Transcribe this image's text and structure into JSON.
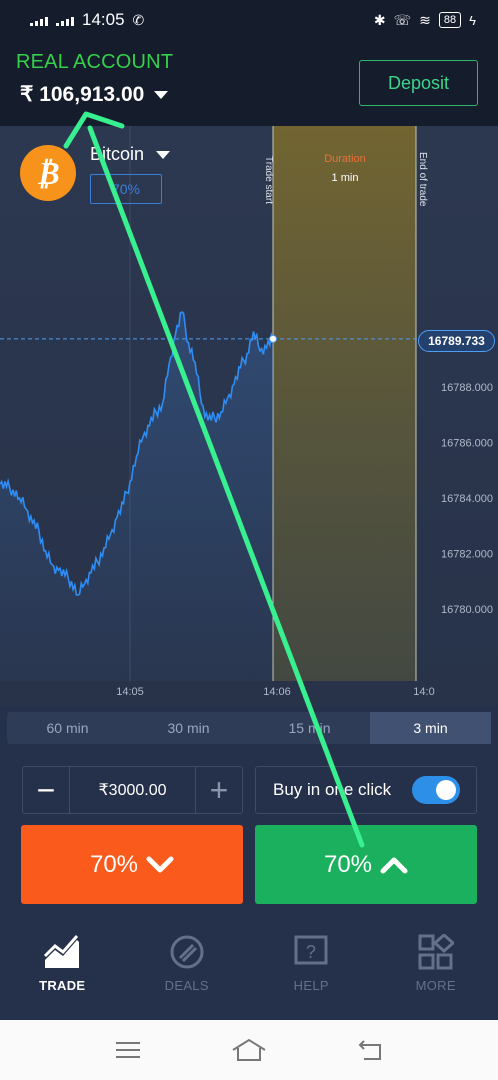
{
  "status_bar": {
    "time": "14:05",
    "battery": "88"
  },
  "header": {
    "account_label": "REAL ACCOUNT",
    "balance": "₹ 106,913.00",
    "deposit_label": "Deposit"
  },
  "asset": {
    "icon_symbol": "₿",
    "name": "Bitcoin",
    "profit": "70%"
  },
  "chart_data": {
    "type": "line",
    "current_price_label": "16789.733",
    "current_price": 16789.733,
    "y_ticks": [
      "16788.000",
      "16786.000",
      "16784.000",
      "16782.000",
      "16780.000"
    ],
    "y_tick_values": [
      16788,
      16786,
      16784,
      16782,
      16780
    ],
    "x_ticks": [
      "14:05",
      "14:06",
      "14:0"
    ],
    "trade_start_label": "Trade start",
    "end_of_trade_label": "End of trade",
    "duration_label": "Duration",
    "duration_value": "1 min",
    "price_series": [
      16784.5,
      16784.4,
      16784.3,
      16784.0,
      16783.6,
      16783.1,
      16782.8,
      16782.1,
      16781.6,
      16781.4,
      16781.2,
      16781.0,
      16780.5,
      16780.9,
      16781.3,
      16781.7,
      16782.2,
      16782.7,
      16783.3,
      16783.8,
      16784.6,
      16785.5,
      16786.2,
      16786.6,
      16787.1,
      16787.4,
      16788.8,
      16789.9,
      16790.7,
      16789.6,
      16788.9,
      16787.4,
      16786.8,
      16786.9,
      16787.1,
      16787.6,
      16788.1,
      16788.7,
      16789.2,
      16790.0,
      16789.3,
      16789.4,
      16789.733
    ]
  },
  "time_tabs": [
    "60 min",
    "30 min",
    "15 min",
    "3 min"
  ],
  "active_tab_index": 3,
  "trade": {
    "amount": "₹3000.00",
    "one_click_label": "Buy in one click",
    "sell_percent": "70%",
    "buy_percent": "70%"
  },
  "bottom_nav": [
    {
      "label": "TRADE"
    },
    {
      "label": "DEALS"
    },
    {
      "label": "HELP"
    },
    {
      "label": "MORE"
    }
  ],
  "colors": {
    "sell": "#fa5a1c",
    "buy": "#1bb05e",
    "accent": "#3ed488",
    "line": "#2f8ef5",
    "overlay_arrow": "#38f08f"
  }
}
